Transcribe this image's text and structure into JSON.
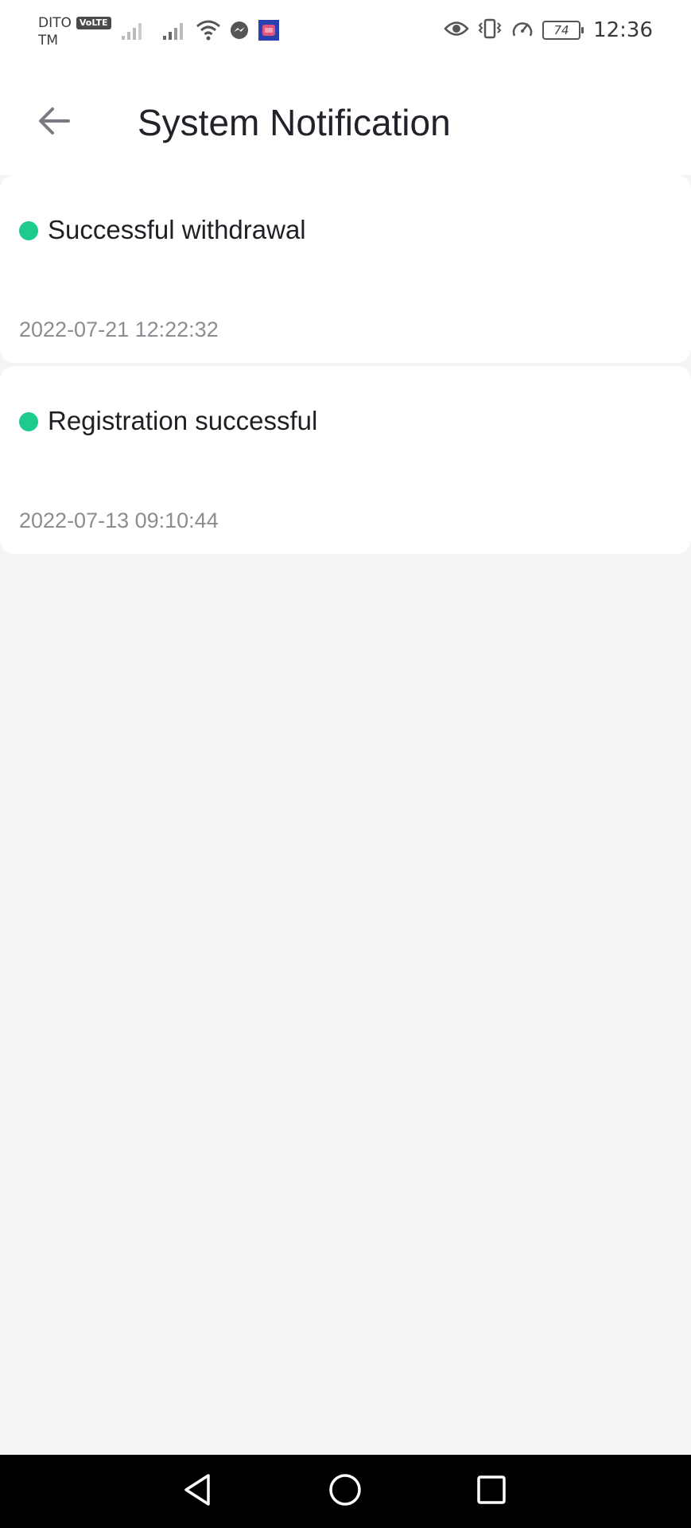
{
  "status_bar": {
    "carrier_line1": "DITO",
    "carrier_badge": "VoLTE",
    "carrier_line2": "TM",
    "battery_level": "74",
    "time": "12:36",
    "icons_left": [
      "signal-icon",
      "signal-icon",
      "wifi-icon",
      "messenger-icon",
      "app-notification-icon"
    ],
    "icons_right": [
      "eye-icon",
      "vibrate-icon",
      "speedometer-icon",
      "battery-icon"
    ]
  },
  "header": {
    "title": "System Notification",
    "back_icon": "arrow-left-icon"
  },
  "notifications": [
    {
      "title": "Successful withdrawal",
      "time": "2022-07-21 12:22:32",
      "dot_color": "#1ecb8c"
    },
    {
      "title": "Registration successful",
      "time": "2022-07-13 09:10:44",
      "dot_color": "#1ecb8c"
    }
  ],
  "nav_bar": {
    "icons": [
      "back-triangle-icon",
      "home-circle-icon",
      "recents-square-icon"
    ]
  },
  "colors": {
    "background": "#f4f4f5",
    "card": "#ffffff",
    "accent_dot": "#1ecb8c",
    "time_text": "#8c8c92"
  }
}
